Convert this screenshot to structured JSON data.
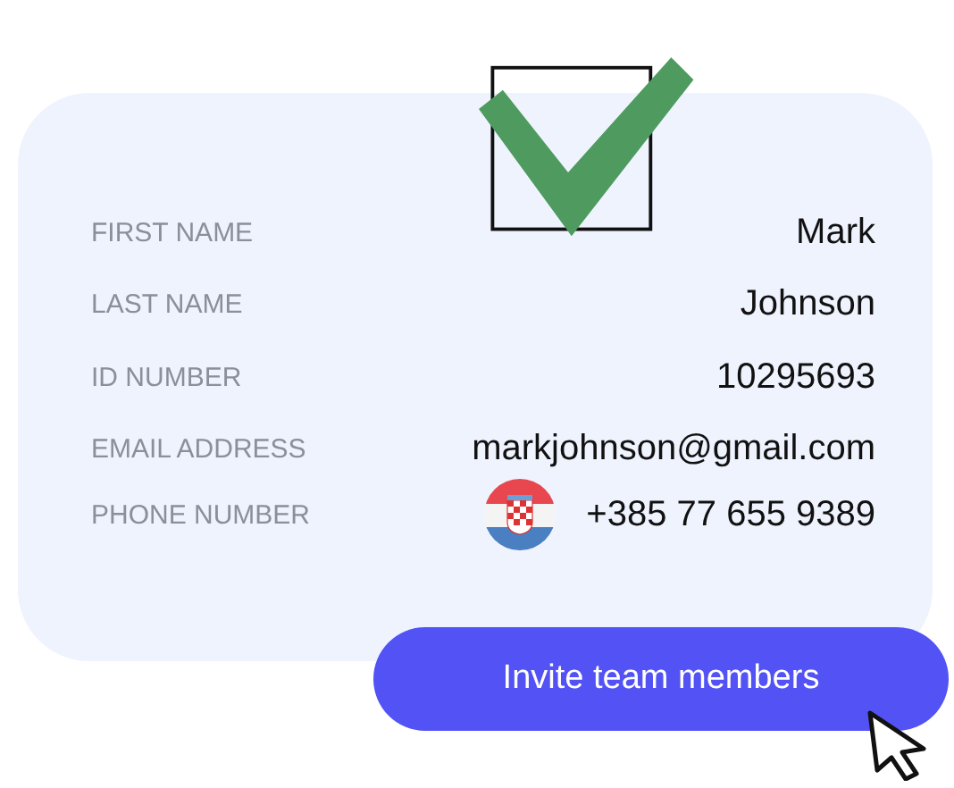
{
  "checkbox": {
    "checked": true
  },
  "fields": [
    {
      "label": "FIRST NAME",
      "value": "Mark"
    },
    {
      "label": "LAST NAME",
      "value": "Johnson"
    },
    {
      "label": "ID NUMBER",
      "value": "10295693"
    },
    {
      "label": "EMAIL ADDRESS",
      "value": "markjohnson@gmail.com"
    },
    {
      "label": "PHONE NUMBER",
      "value": "+385 77 655 9389",
      "kind": "phone"
    }
  ],
  "button": {
    "label": "Invite team members"
  }
}
